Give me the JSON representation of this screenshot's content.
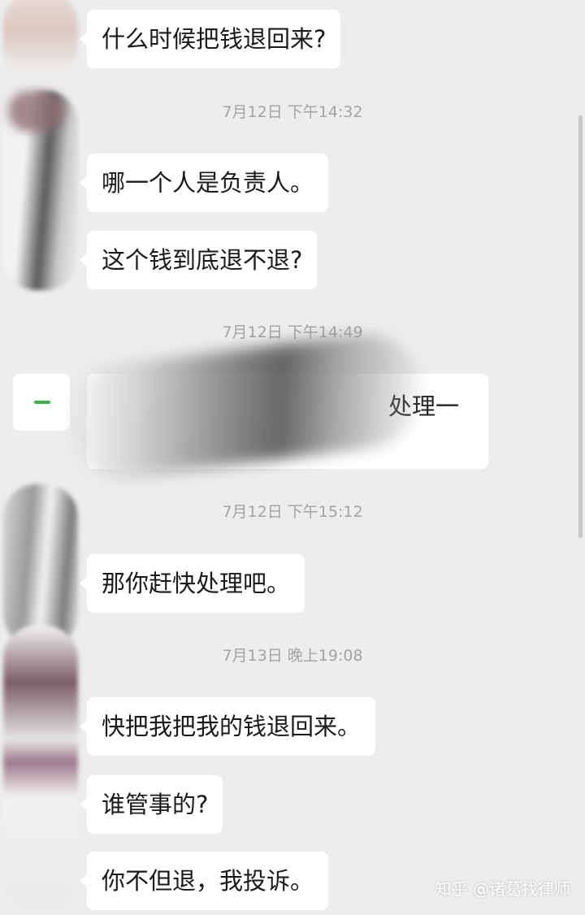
{
  "messages": [
    {
      "text": "什么时候把钱退回来?"
    },
    {
      "text": "哪一个人是负责人。"
    },
    {
      "text": "这个钱到底退不退?"
    },
    {
      "text": "处理一"
    },
    {
      "text": "那你赶快处理吧。"
    },
    {
      "text": "快把我把我的钱退回来。"
    },
    {
      "text": "谁管事的?"
    },
    {
      "text": "你不但退，我投诉。"
    }
  ],
  "timestamps": [
    "7月12日 下午14:32",
    "7月12日 下午14:49",
    "7月12日 下午15:12",
    "7月13日 晚上19:08"
  ],
  "watermark": "知乎 @诸葛找律师",
  "colors": {
    "background": "#ededed",
    "bubble": "#ffffff",
    "timestamp": "#a3a3a3",
    "accent_green": "#39b44a"
  }
}
